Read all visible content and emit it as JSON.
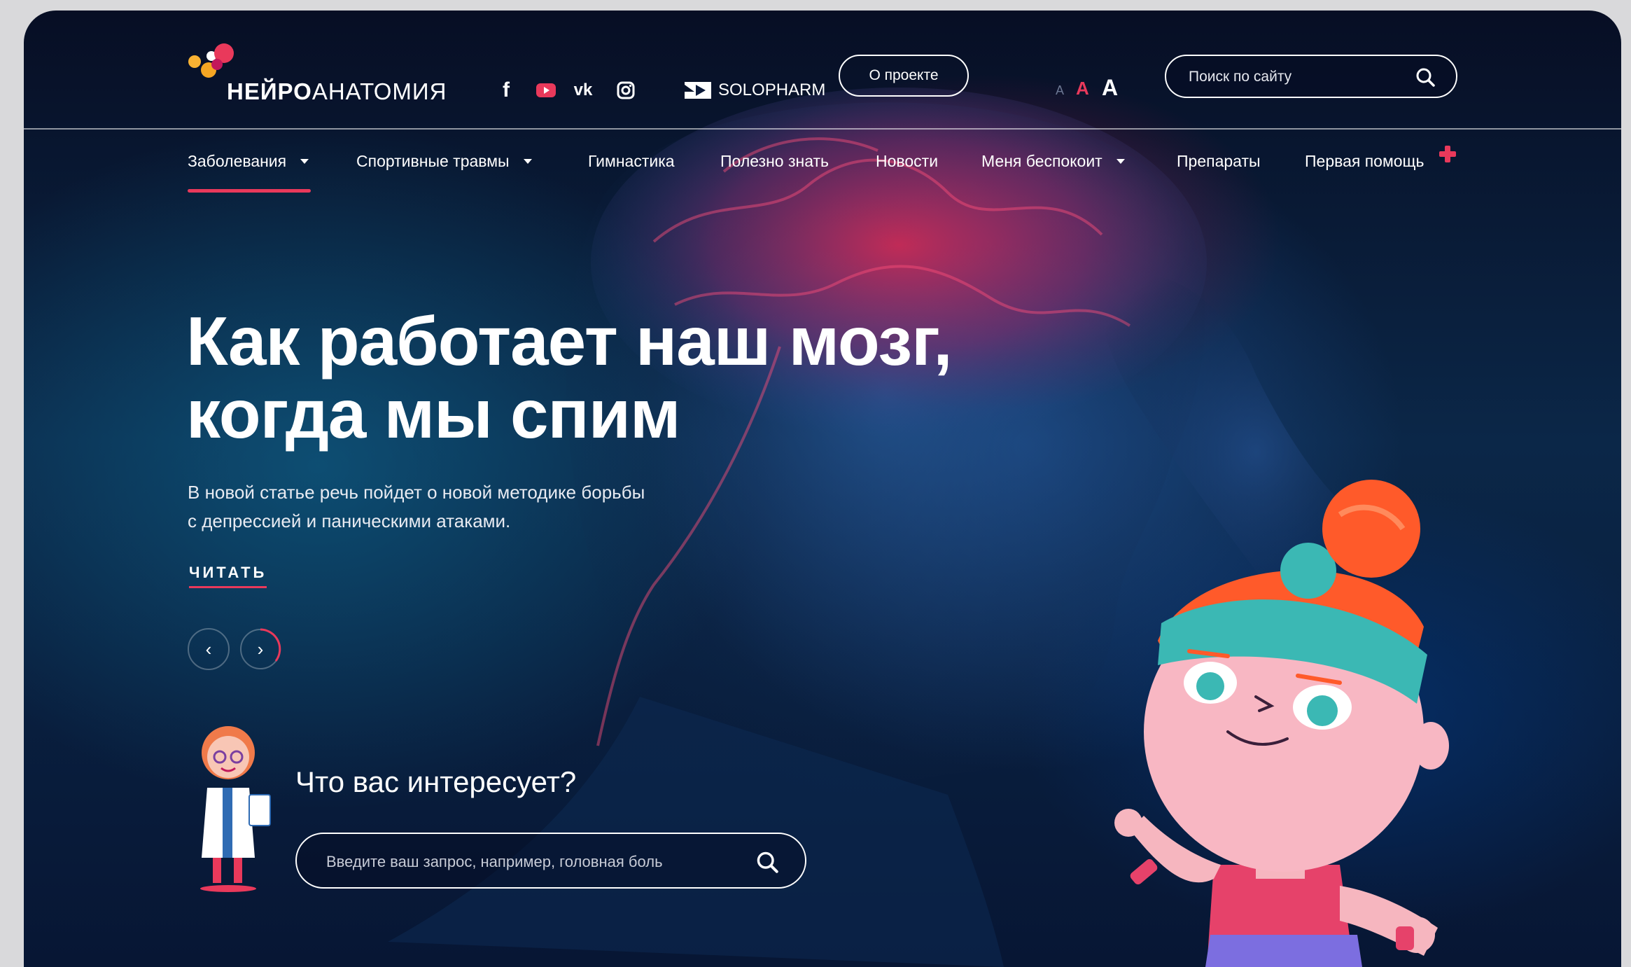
{
  "header": {
    "logo": {
      "text_bold": "НЕЙРО",
      "text_light": "АНАТОМИЯ"
    },
    "social": [
      {
        "name": "facebook-icon",
        "glyph": "f"
      },
      {
        "name": "youtube-icon",
        "glyph": "▶"
      },
      {
        "name": "vk-icon",
        "glyph": "vk"
      },
      {
        "name": "instagram-icon",
        "glyph": "◎"
      }
    ],
    "sponsor": "SOLOPHARM",
    "about_label": "О проекте",
    "font_size": {
      "small": "A",
      "medium": "A",
      "large": "A"
    },
    "search_placeholder": "Поиск по сайту"
  },
  "nav": {
    "items": [
      {
        "label": "Заболевания",
        "dropdown": true,
        "active": true
      },
      {
        "label": "Спортивные травмы",
        "dropdown": true
      },
      {
        "label": "Гимнастика"
      },
      {
        "label": "Полезно знать"
      },
      {
        "label": "Новости"
      },
      {
        "label": "Меня беспокоит",
        "dropdown": true
      },
      {
        "label": "Препараты"
      },
      {
        "label": "Первая помощь"
      }
    ]
  },
  "hero": {
    "title_line1": "Как работает наш мозг,",
    "title_line2": "когда мы спим",
    "subtitle_line1": "В новой статье речь пойдет о новой методике борьбы",
    "subtitle_line2": "с депрессией и паническими атаками.",
    "read_label": "ЧИТАТЬ",
    "prev_glyph": "‹",
    "next_glyph": "›"
  },
  "interest": {
    "title": "Что вас интересует?",
    "placeholder": "Введите ваш запрос, например, головная боль"
  },
  "colors": {
    "accent": "#e9395b",
    "background_dark": "#0b2748"
  }
}
